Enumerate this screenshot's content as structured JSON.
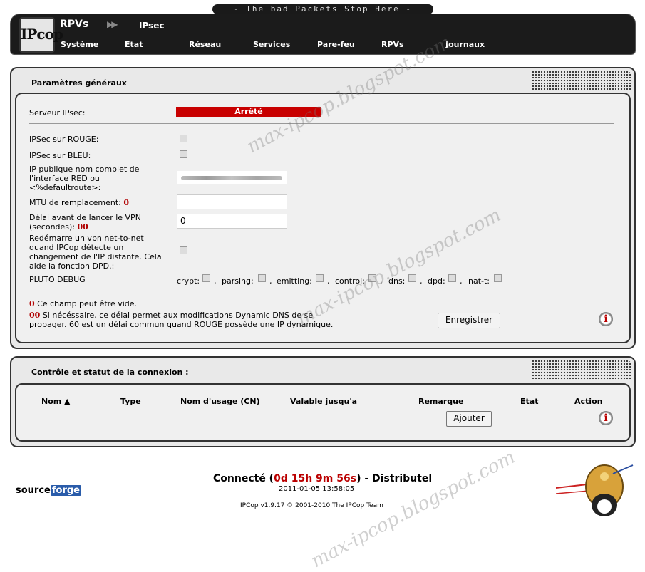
{
  "header": {
    "banner": "- The bad Packets Stop Here -",
    "logo_text": "IPcop",
    "breadcrumb_main": "RPVs",
    "breadcrumb_arrow": "▶▶",
    "breadcrumb_sub": "IPsec",
    "nav": [
      "Système",
      "Etat",
      "Réseau",
      "Services",
      "Pare-feu",
      "RPVs",
      "Journaux"
    ]
  },
  "general": {
    "title": "Paramètres généraux",
    "server_label": "Serveur IPsec:",
    "server_status": "Arrêté",
    "ipsec_red_label": "IPSec sur ROUGE:",
    "ipsec_blue_label": "IPSec sur BLEU:",
    "public_ip_label": "IP publique nom complet de l'interface RED ou <%defaultroute>:",
    "mtu_label": "MTU de remplacement:",
    "delay_label": "Délai avant de lancer le VPN (secondes):",
    "delay_value": "0",
    "restart_label": "Redémarre un vpn net-to-net quand IPCop détecte un changement de l'IP distante. Cela aide la fonction DPD.:",
    "pluto_label": "PLUTO DEBUG",
    "pluto_options": [
      "crypt:",
      "parsing:",
      "emitting:",
      "control:",
      "dns:",
      "dpd:",
      "nat-t:"
    ],
    "mark_single": "0",
    "mark_double": "00",
    "note1": "Ce champ peut être vide.",
    "note2": "Si nécéssaire, ce délai permet aux modifications Dynamic DNS de se propager. 60 est un délai commun quand ROUGE possède une IP dynamique.",
    "save_button": "Enregistrer",
    "info_icon": "i"
  },
  "connections": {
    "title": "Contrôle et statut de la connexion :",
    "columns": [
      "Nom ▲",
      "Type",
      "Nom d'usage (CN)",
      "Valable jusqu'a",
      "Remarque",
      "Etat",
      "Action"
    ],
    "add_button": "Ajouter",
    "info_icon": "i"
  },
  "footer": {
    "connected_prefix": "Connecté (",
    "uptime": "0d 15h 9m 56s",
    "connected_suffix": ") - Distributel",
    "datetime": "2011-01-05 13:58:05",
    "credit": "IPCop v1.9.17 © 2001-2010 The IPCop Team",
    "sourceforge_a": "source",
    "sourceforge_b": "forge"
  },
  "watermark": "max-ipcop.blogspot.com",
  "colors": {
    "status_red": "#c80000",
    "dark": "#1b1b1b"
  }
}
